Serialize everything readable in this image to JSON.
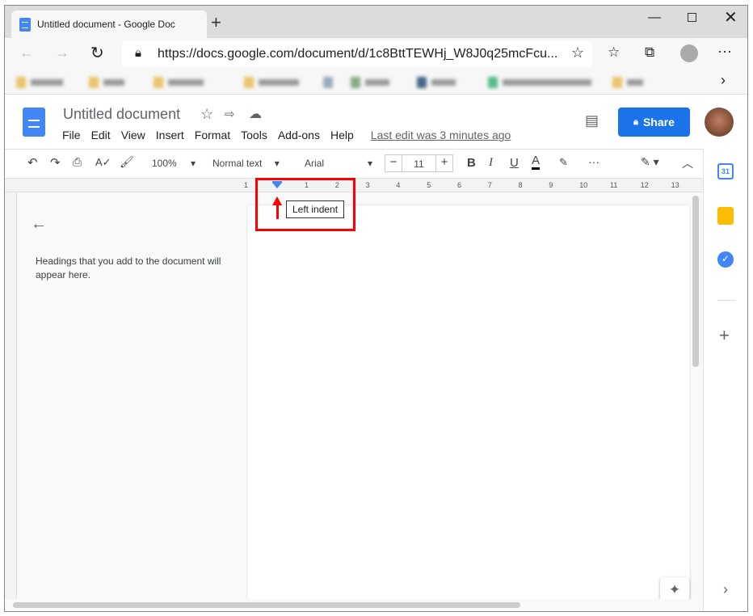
{
  "browser": {
    "tab_title": "Untitled document - Google Doc",
    "url": "https://docs.google.com/document/d/1c8BttTEWHj_W8J0q25mcFcu..."
  },
  "doc": {
    "title": "Untitled document",
    "menu": [
      "File",
      "Edit",
      "View",
      "Insert",
      "Format",
      "Tools",
      "Add-ons",
      "Help"
    ],
    "last_edit": "Last edit was 3 minutes ago",
    "share": "Share"
  },
  "toolbar": {
    "zoom": "100%",
    "style": "Normal text",
    "font": "Arial",
    "font_size": "11"
  },
  "ruler": {
    "labels": [
      "1",
      "1",
      "2",
      "3",
      "4",
      "5",
      "6",
      "7",
      "8",
      "9",
      "10",
      "11",
      "12",
      "13"
    ]
  },
  "outline": {
    "message": "Headings that you add to the document will appear here."
  },
  "tooltip": {
    "text": "Left indent"
  },
  "colors": {
    "accent": "#1a73e8",
    "highlight": "#ff0000"
  }
}
